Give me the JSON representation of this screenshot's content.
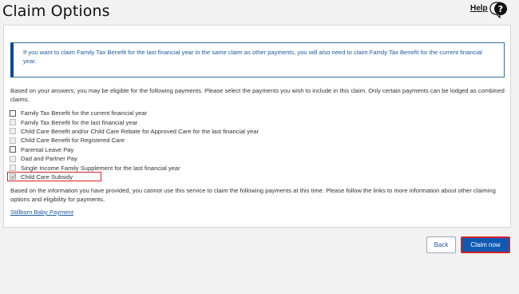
{
  "header": {
    "title": "Claim Options",
    "help_label": "Help"
  },
  "info_box": {
    "text": "If you want to claim Family Tax Benefit for the last financial year in the same claim as other payments, you will also need to claim Family Tax Benefit for the current financial year."
  },
  "intro_text": "Based on your answers, you may be eligible for the following payments. Please select the payments you wish to include in this claim. Only certain payments can be lodged as combined claims.",
  "payments": [
    {
      "label": "Family Tax Benefit for the current financial year",
      "state": "unchecked"
    },
    {
      "label": "Family Tax Benefit for the last financial year",
      "state": "disabled"
    },
    {
      "label": "Child Care Benefit and/or Child Care Rebate for Approved Care for the last financial year",
      "state": "disabled"
    },
    {
      "label": "Child Care Benefit for Registered Care",
      "state": "disabled"
    },
    {
      "label": "Parental Leave Pay",
      "state": "unchecked"
    },
    {
      "label": "Dad and Partner Pay",
      "state": "disabled"
    },
    {
      "label": "Single Income Family Supplement for the last financial year",
      "state": "disabled"
    },
    {
      "label": "Child Care Subsidy",
      "state": "checked-disabled"
    }
  ],
  "outro_text": "Based on the information you have provided, you cannot use this service to claim the following payments at this time. Please follow the links to more information about other claiming options and eligibility for payments.",
  "links": {
    "stillborn": "Stillborn Baby Payment"
  },
  "buttons": {
    "back": "Back",
    "claim_now": "Claim now"
  },
  "colors": {
    "primary": "#1059b3",
    "highlight": "#d6202a",
    "info_text": "#1f5aa0"
  },
  "icons": {
    "help": "question-speech-bubble-icon"
  }
}
